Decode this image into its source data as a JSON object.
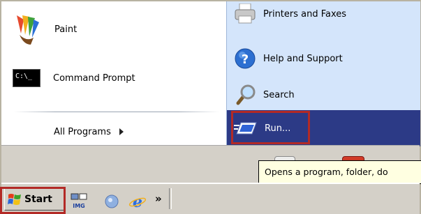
{
  "left_column": {
    "pinned": [
      {
        "label": "Paint",
        "icon": "paint-icon"
      },
      {
        "label": "Command Prompt",
        "icon": "command-prompt-icon",
        "icon_text": "C:\\_"
      }
    ],
    "all_programs": {
      "label": "All Programs",
      "icon": "arrow-right-icon"
    }
  },
  "right_column": {
    "items": [
      {
        "label": "Printers and Faxes",
        "icon": "printer-icon"
      },
      {
        "label": "Help and Support",
        "icon": "help-icon"
      },
      {
        "label": "Search",
        "icon": "search-icon"
      },
      {
        "label": "Run...",
        "icon": "run-icon",
        "highlighted": true
      }
    ]
  },
  "tooltip": {
    "text": "Opens a program, folder, do"
  },
  "taskbar": {
    "start_label": "Start",
    "quick_launch": [
      "img-icon",
      "desktop-icon",
      "ie-icon"
    ],
    "overflow": "»"
  },
  "colors": {
    "highlight_border": "#b32a26",
    "run_background": "#2c3a86",
    "right_panel": "#d4e5fb",
    "tooltip_bg": "#ffffe1"
  }
}
